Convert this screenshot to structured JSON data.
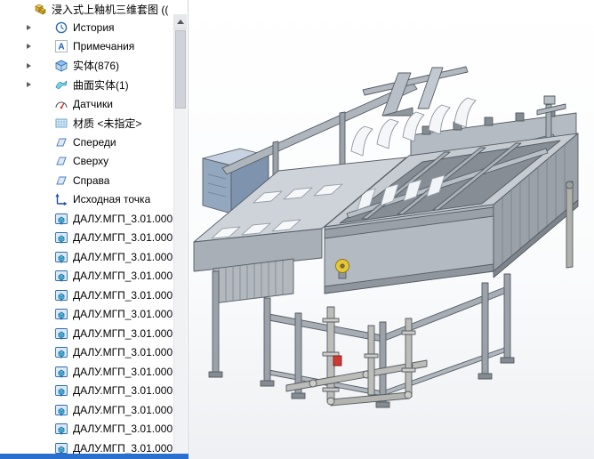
{
  "tree": {
    "root": {
      "label": "浸入式上釉机三维套图 ((",
      "icon": "assembly-icon"
    },
    "items": [
      {
        "label": "История",
        "icon": "history-icon",
        "expandable": true
      },
      {
        "label": "Примечания",
        "icon": "annotations-icon",
        "expandable": true
      },
      {
        "label": "实体(876)",
        "icon": "solid-bodies-icon",
        "expandable": true
      },
      {
        "label": "曲面实体(1)",
        "icon": "surface-bodies-icon",
        "expandable": true
      },
      {
        "label": "Датчики",
        "icon": "sensors-icon",
        "expandable": false
      },
      {
        "label": "材质 <未指定>",
        "icon": "material-icon",
        "expandable": false
      },
      {
        "label": "Спереди",
        "icon": "plane-icon",
        "expandable": false
      },
      {
        "label": "Сверху",
        "icon": "plane-icon",
        "expandable": false
      },
      {
        "label": "Справа",
        "icon": "plane-icon",
        "expandable": false
      },
      {
        "label": "Исходная точка",
        "icon": "origin-icon",
        "expandable": false
      },
      {
        "label": "ДАЛУ.МГП_3.01.000",
        "icon": "component-icon"
      },
      {
        "label": "ДАЛУ.МГП_3.01.000",
        "icon": "component-icon"
      },
      {
        "label": "ДАЛУ.МГП_3.01.000",
        "icon": "component-icon"
      },
      {
        "label": "ДАЛУ.МГП_3.01.000",
        "icon": "component-icon"
      },
      {
        "label": "ДАЛУ.МГП_3.01.000",
        "icon": "component-icon"
      },
      {
        "label": "ДАЛУ.МГП_3.01.000",
        "icon": "component-icon"
      },
      {
        "label": "ДАЛУ.МГП_3.01.000",
        "icon": "component-icon"
      },
      {
        "label": "ДАЛУ.МГП_3.01.000",
        "icon": "component-icon"
      },
      {
        "label": "ДАЛУ.МГП_3.01.000",
        "icon": "component-icon"
      },
      {
        "label": "ДАЛУ.МГП_3.01.000",
        "icon": "component-icon"
      },
      {
        "label": "ДАЛУ.МГП_3.01.000",
        "icon": "component-icon"
      },
      {
        "label": "ДАЛУ.МГП_3.01.000",
        "icon": "component-icon"
      },
      {
        "label": "ДАЛУ.МГП_3.01.000",
        "icon": "component-icon"
      }
    ]
  },
  "colors": {
    "bottom_strip_blue": "#2a6fce",
    "machine_gray": "#b9bfc6",
    "cabinet_blue": "#93a7bf",
    "valve_yellow": "#e8c832",
    "valve_red": "#cc3a33"
  }
}
